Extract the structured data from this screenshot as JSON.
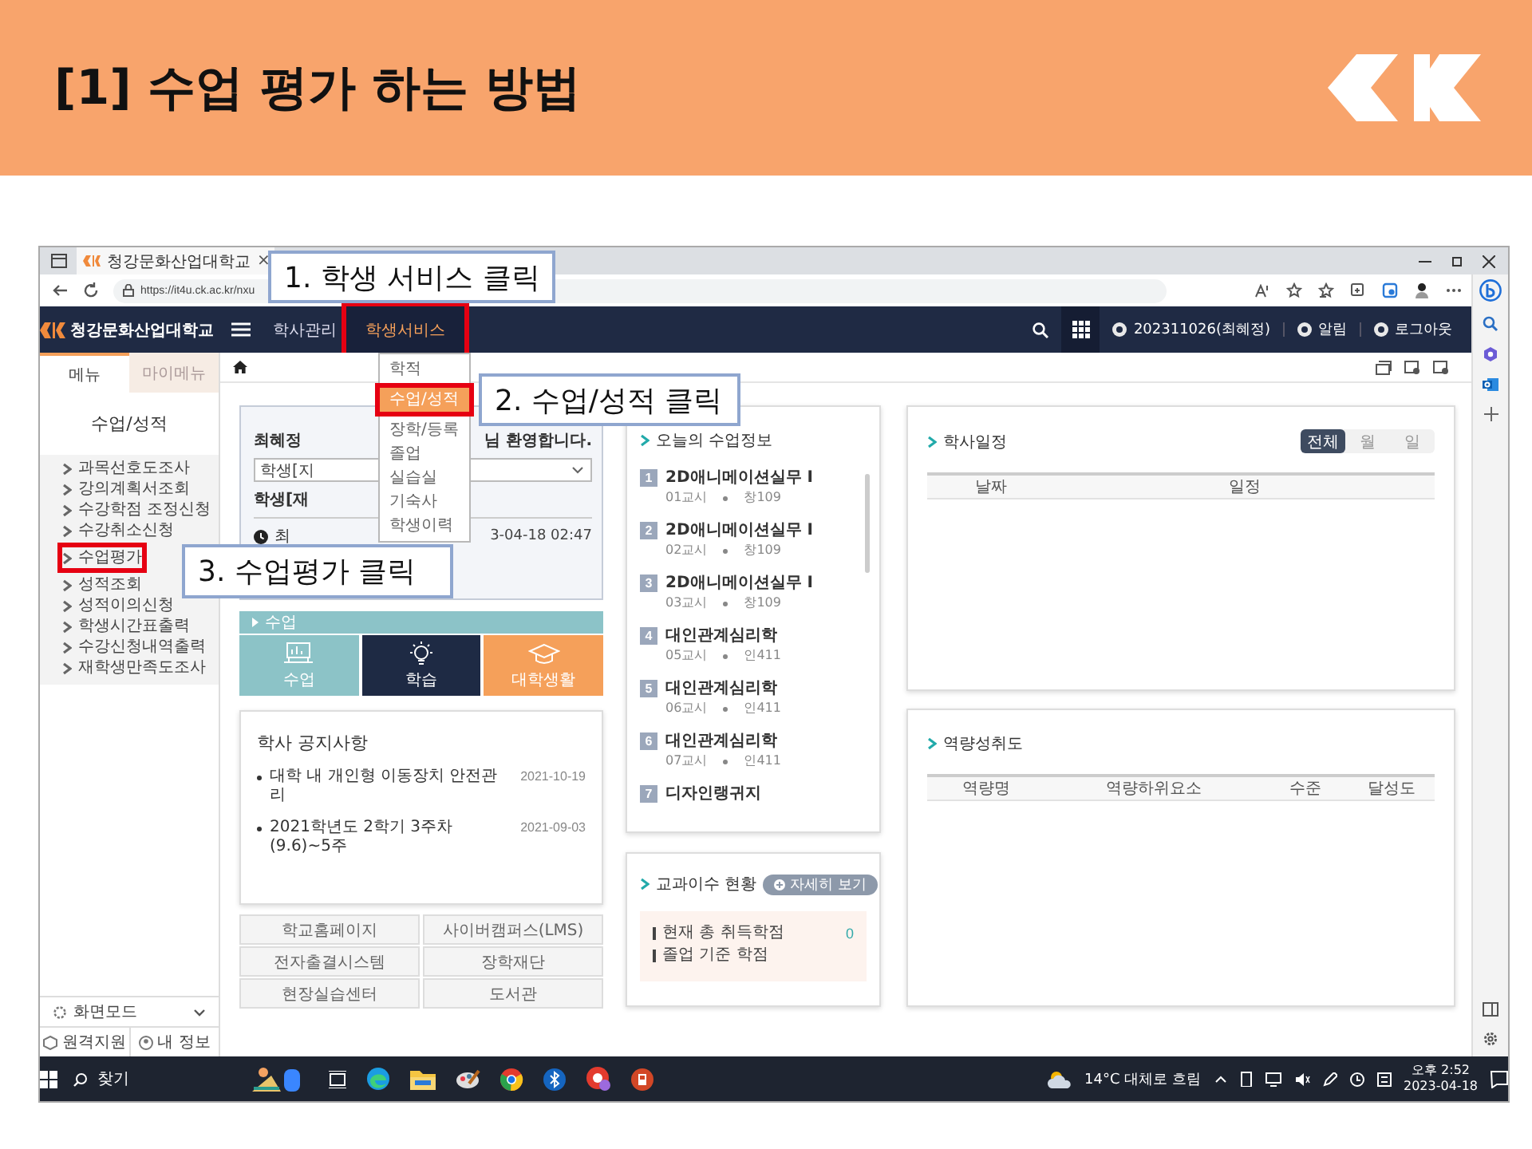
{
  "slide": {
    "title": "[1] 수업 평가 하는 방법"
  },
  "browser": {
    "tab_title": "청강문화산업대학교",
    "tab_close": "×",
    "url": "https://it4u.ck.ac.kr/nxu"
  },
  "portal": {
    "school_name": "청강문화산업대학교",
    "nav": [
      {
        "label": "학사관리",
        "selected": false,
        "highlighted": false
      },
      {
        "label": "학생서비스",
        "selected": true,
        "highlighted": true
      }
    ],
    "user": "202311026(최혜정)",
    "alarm": "알림",
    "logout": "로그아웃",
    "menu": [
      {
        "label": "학적",
        "selected": false,
        "highlighted": false
      },
      {
        "label": "수업/성적",
        "selected": true,
        "highlighted": true
      },
      {
        "label": "장학/등록",
        "selected": false,
        "highlighted": false
      },
      {
        "label": "졸업",
        "selected": false,
        "highlighted": false
      },
      {
        "label": "실습실",
        "selected": false,
        "highlighted": false
      },
      {
        "label": "기숙사",
        "selected": false,
        "highlighted": false
      },
      {
        "label": "학생이력",
        "selected": false,
        "highlighted": false
      }
    ]
  },
  "sidebar": {
    "tabs": [
      {
        "label": "메뉴",
        "selected": true
      },
      {
        "label": "마이메뉴",
        "selected": false
      }
    ],
    "title": "수업/성적",
    "items": [
      {
        "label": "과목선호도조사",
        "highlighted": false
      },
      {
        "label": "강의계획서조회",
        "highlighted": false
      },
      {
        "label": "수강학점 조정신청",
        "highlighted": false
      },
      {
        "label": "수강취소신청",
        "highlighted": false
      },
      {
        "label": "수업평가",
        "highlighted": true
      },
      {
        "label": "성적조회",
        "highlighted": false
      },
      {
        "label": "성적이의신청",
        "highlighted": false
      },
      {
        "label": "학생시간표출력",
        "highlighted": false
      },
      {
        "label": "수강신청내역출력",
        "highlighted": false
      },
      {
        "label": "재학생만족도조사",
        "highlighted": false
      }
    ],
    "screen_mode": "화면모드",
    "remote_support": "원격지원",
    "my_info": "내 정보"
  },
  "welcome": {
    "name": "최혜정",
    "greeting": "님 환영합니다.",
    "select_value": "학생[지",
    "status": "학생[재",
    "login_label": "최",
    "login_time": "3-04-18 02:47"
  },
  "classes_panel": {
    "title": "수업",
    "tiles": [
      {
        "label": "수업",
        "kind": "class",
        "color": "#8cc3c7"
      },
      {
        "label": "학습",
        "kind": "study",
        "color": "#1e2a44"
      },
      {
        "label": "대학생활",
        "kind": "campus",
        "color": "#f5a05a"
      }
    ]
  },
  "notices": {
    "title": "학사 공지사항",
    "items": [
      {
        "text": "대학 내 개인형 이동장치 안전관리",
        "date": "2021-10-19"
      },
      {
        "text": "2021학년도 2학기 3주차(9.6)~5주",
        "date": "2021-09-03"
      }
    ]
  },
  "links": [
    "학교홈페이지",
    "사이버캠퍼스(LMS)",
    "전자출결시스템",
    "장학재단",
    "현장실습센터",
    "도서관"
  ],
  "today": {
    "title": "오늘의 수업정보",
    "classes": [
      {
        "number": "1",
        "name": "2D애니메이션실무 Ⅰ",
        "period": "01교시",
        "room": "창109"
      },
      {
        "number": "2",
        "name": "2D애니메이션실무 Ⅰ",
        "period": "02교시",
        "room": "창109"
      },
      {
        "number": "3",
        "name": "2D애니메이션실무 Ⅰ",
        "period": "03교시",
        "room": "창109"
      },
      {
        "number": "4",
        "name": "대인관계심리학",
        "period": "05교시",
        "room": "인411"
      },
      {
        "number": "5",
        "name": "대인관계심리학",
        "period": "06교시",
        "room": "인411"
      },
      {
        "number": "6",
        "name": "대인관계심리학",
        "period": "07교시",
        "room": "인411"
      },
      {
        "number": "7",
        "name": "디자인랭귀지"
      }
    ]
  },
  "credits": {
    "title": "교과이수 현황",
    "button": "자세히 보기",
    "rows": [
      {
        "label": "현재 총 취득학점",
        "value": "0"
      },
      {
        "label": "졸업 기준 학점"
      }
    ]
  },
  "schedule": {
    "title": "학사일정",
    "filters": [
      {
        "label": "전체",
        "selected": true
      },
      {
        "label": "월",
        "selected": false
      },
      {
        "label": "일",
        "selected": false
      }
    ],
    "columns": [
      "날짜",
      "일정"
    ]
  },
  "competency": {
    "title": "역량성취도",
    "columns": [
      "역량명",
      "역량하위요소",
      "수준",
      "달성도"
    ]
  },
  "taskbar": {
    "search": "찾기",
    "weather": "14°C 대체로 흐림",
    "time": "오후 2:52",
    "date": "2023-04-18"
  },
  "callouts": [
    "1. 학생 서비스 클릭",
    "2. 수업/성적 클릭",
    "3. 수업평가 클릭"
  ]
}
